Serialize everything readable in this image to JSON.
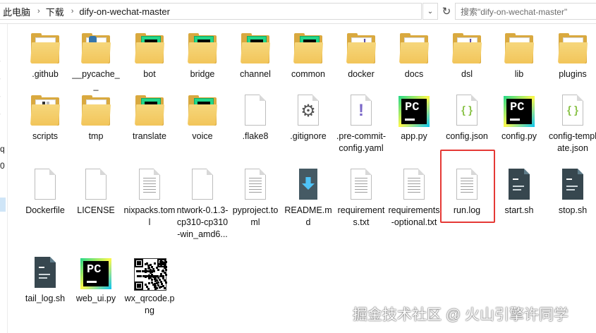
{
  "address_bar": {
    "breadcrumbs": [
      "此电脑",
      "下载",
      "dify-on-wechat-master"
    ],
    "search_placeholder": "搜索\"dify-on-wechat-master\""
  },
  "nav_fragments": [
    "q",
    "0"
  ],
  "files": [
    {
      "name": ".github",
      "kind": "folder"
    },
    {
      "name": "__pycache__",
      "kind": "folder-python"
    },
    {
      "name": "bot",
      "kind": "folder-pycharm"
    },
    {
      "name": "bridge",
      "kind": "folder-pycharm"
    },
    {
      "name": "channel",
      "kind": "folder-pycharm"
    },
    {
      "name": "common",
      "kind": "folder-pycharm"
    },
    {
      "name": "docker",
      "kind": "folder-excl"
    },
    {
      "name": "docs",
      "kind": "folder"
    },
    {
      "name": "dsl",
      "kind": "folder-excl"
    },
    {
      "name": "lib",
      "kind": "folder"
    },
    {
      "name": "plugins",
      "kind": "folder"
    },
    {
      "name": "scripts",
      "kind": "folder-bars"
    },
    {
      "name": "tmp",
      "kind": "folder"
    },
    {
      "name": "translate",
      "kind": "folder-pycharm"
    },
    {
      "name": "voice",
      "kind": "folder-pycharm"
    },
    {
      "name": ".flake8",
      "kind": "blank"
    },
    {
      "name": ".gitignore",
      "kind": "gear"
    },
    {
      "name": ".pre-commit-config.yaml",
      "kind": "excl-doc"
    },
    {
      "name": "app.py",
      "kind": "pycharm"
    },
    {
      "name": "config.json",
      "kind": "json",
      "selected": true
    },
    {
      "name": "config.py",
      "kind": "pycharm"
    },
    {
      "name": "config-template.json",
      "kind": "json"
    },
    {
      "name": "Dockerfile",
      "kind": "blank"
    },
    {
      "name": "LICENSE",
      "kind": "blank"
    },
    {
      "name": "nixpacks.toml",
      "kind": "text"
    },
    {
      "name": "ntwork-0.1.3-cp310-cp310-win_amd6...",
      "kind": "blank"
    },
    {
      "name": "pyproject.toml",
      "kind": "text"
    },
    {
      "name": "README.md",
      "kind": "readme"
    },
    {
      "name": "requirements.txt",
      "kind": "text"
    },
    {
      "name": "requirements-optional.txt",
      "kind": "text"
    },
    {
      "name": "run.log",
      "kind": "text"
    },
    {
      "name": "start.sh",
      "kind": "shell"
    },
    {
      "name": "stop.sh",
      "kind": "shell"
    },
    {
      "name": "tail_log.sh",
      "kind": "shell"
    },
    {
      "name": "web_ui.py",
      "kind": "pycharm"
    },
    {
      "name": "wx_qrcode.png",
      "kind": "qrcode"
    }
  ],
  "watermark": "掘金技术社区 @ 火山引擎许同学",
  "colors": {
    "selection_border": "#e53935",
    "folder": "#f2c55a",
    "json_brace": "#8bc34a",
    "excl": "#7b68c8"
  }
}
